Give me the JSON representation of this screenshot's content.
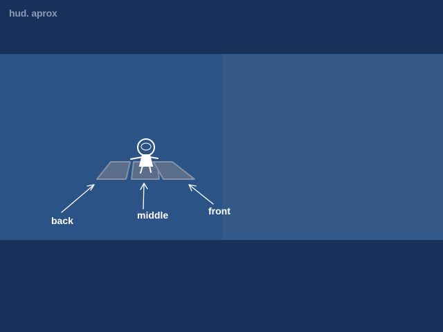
{
  "title": "hud. aprox",
  "labels": {
    "back": "back",
    "middle": "middle",
    "front": "front"
  },
  "colors": {
    "dark_band": "#18315a",
    "left_panel": "#2c5386",
    "right_panel": "#355a89",
    "title_text": "#8a9ab8",
    "tile_fill": "#5a6d8a",
    "tile_edge": "#8592a8",
    "ink": "#ffffff"
  }
}
